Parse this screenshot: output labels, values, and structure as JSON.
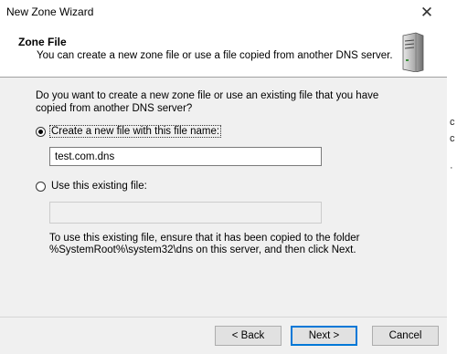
{
  "window": {
    "title": "New Zone Wizard"
  },
  "header": {
    "title": "Zone File",
    "subtitle": "You can create a new zone file or use a file copied from another DNS server."
  },
  "content": {
    "question": "Do you want to create a new zone file or use an existing file that you have copied from another DNS server?",
    "option_new": {
      "label": "Create a new file with this file name:",
      "selected": true,
      "value": "test.com.dns"
    },
    "option_existing": {
      "label": "Use this existing file:",
      "selected": false,
      "value": ""
    },
    "note": "To use this existing file, ensure that it has been copied to the folder %SystemRoot%\\system32\\dns on this server, and then click Next."
  },
  "footer": {
    "back_label": "< Back",
    "next_label": "Next >",
    "cancel_label": "Cancel"
  },
  "icons": {
    "close": "close-icon",
    "server": "server-icon"
  },
  "colors": {
    "accent": "#0078d7"
  }
}
